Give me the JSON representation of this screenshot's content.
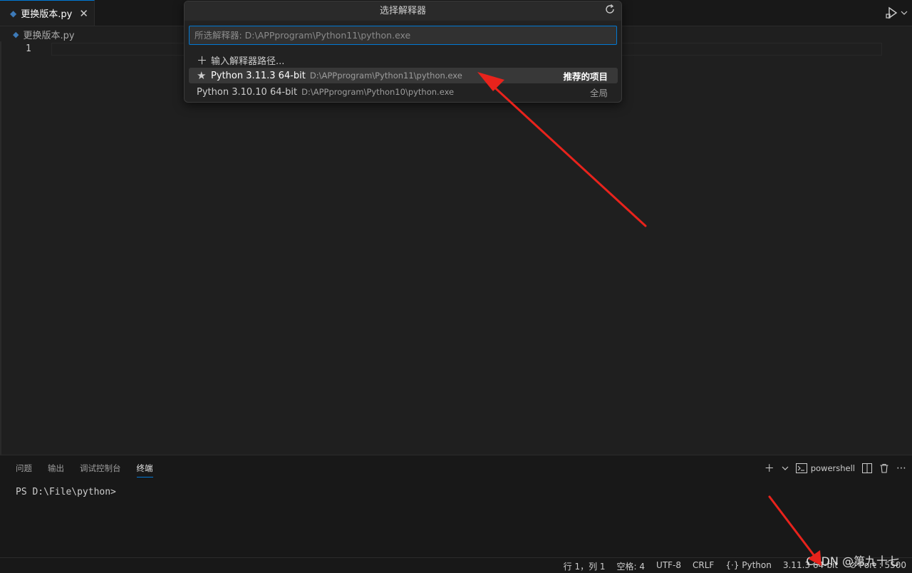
{
  "tab": {
    "title": "更换版本.py",
    "close_glyph": "✕"
  },
  "breadcrumb": {
    "file": "更换版本.py"
  },
  "editor": {
    "line_number": "1"
  },
  "quickpick": {
    "title": "选择解释器",
    "input_placeholder": "所选解释器: D:\\APPprogram\\Python11\\python.exe",
    "items": [
      {
        "icon": "plus-icon",
        "label": "输入解释器路径...",
        "description": "",
        "detail": ""
      },
      {
        "icon": "star-icon",
        "label": "Python 3.11.3 64-bit",
        "description": "D:\\APPprogram\\Python11\\python.exe",
        "detail": "推荐的项目"
      },
      {
        "icon": "",
        "label": "Python 3.10.10 64-bit",
        "description": "D:\\APPprogram\\Python10\\python.exe",
        "detail": "全局"
      }
    ]
  },
  "panel": {
    "tabs": [
      "问题",
      "输出",
      "调试控制台",
      "终端"
    ],
    "active_tab": "终端",
    "shell_name": "powershell",
    "terminal_prompt": "PS D:\\File\\python>"
  },
  "statusbar": {
    "position": "行 1，列 1",
    "indent": "空格: 4",
    "encoding": "UTF-8",
    "eol": "CRLF",
    "language": "Python",
    "interpreter": "3.11.3 64-bit",
    "port": "Port : 5500"
  },
  "watermark": "CSDN @第九十七",
  "colors": {
    "accent": "#0078d4",
    "annotation": "#e8231c",
    "background": "#1f1f1f"
  }
}
